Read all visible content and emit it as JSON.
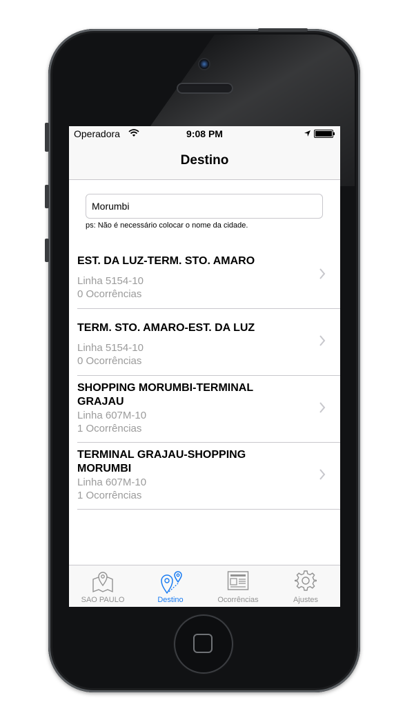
{
  "status": {
    "carrier": "Operadora",
    "time": "9:08 PM"
  },
  "nav": {
    "title": "Destino"
  },
  "search": {
    "value": "Morumbi",
    "hint": "ps: Não é necessário colocar o nome da cidade."
  },
  "routes": [
    {
      "title": "EST. DA LUZ-TERM. STO. AMARO",
      "line": "Linha 5154-10",
      "occurrences": "0 Ocorrências"
    },
    {
      "title": "TERM. STO. AMARO-EST. DA LUZ",
      "line": "Linha 5154-10",
      "occurrences": "0 Ocorrências"
    },
    {
      "title": "SHOPPING MORUMBI-TERMINAL GRAJAU",
      "line": "Linha 607M-10",
      "occurrences": "1 Ocorrências"
    },
    {
      "title": "TERMINAL GRAJAU-SHOPPING MORUMBI",
      "line": "Linha 607M-10",
      "occurrences": "1 Ocorrências"
    }
  ],
  "tabs": [
    {
      "label": "SAO PAULO",
      "icon": "map-pin-icon"
    },
    {
      "label": "Destino",
      "icon": "route-pins-icon",
      "active": true
    },
    {
      "label": "Ocorrências",
      "icon": "newspaper-icon"
    },
    {
      "label": "Ajustes",
      "icon": "gear-icon"
    }
  ],
  "colors": {
    "accent": "#1a7cf2",
    "inactive": "#929292",
    "subtitle": "#9b9b9b"
  }
}
